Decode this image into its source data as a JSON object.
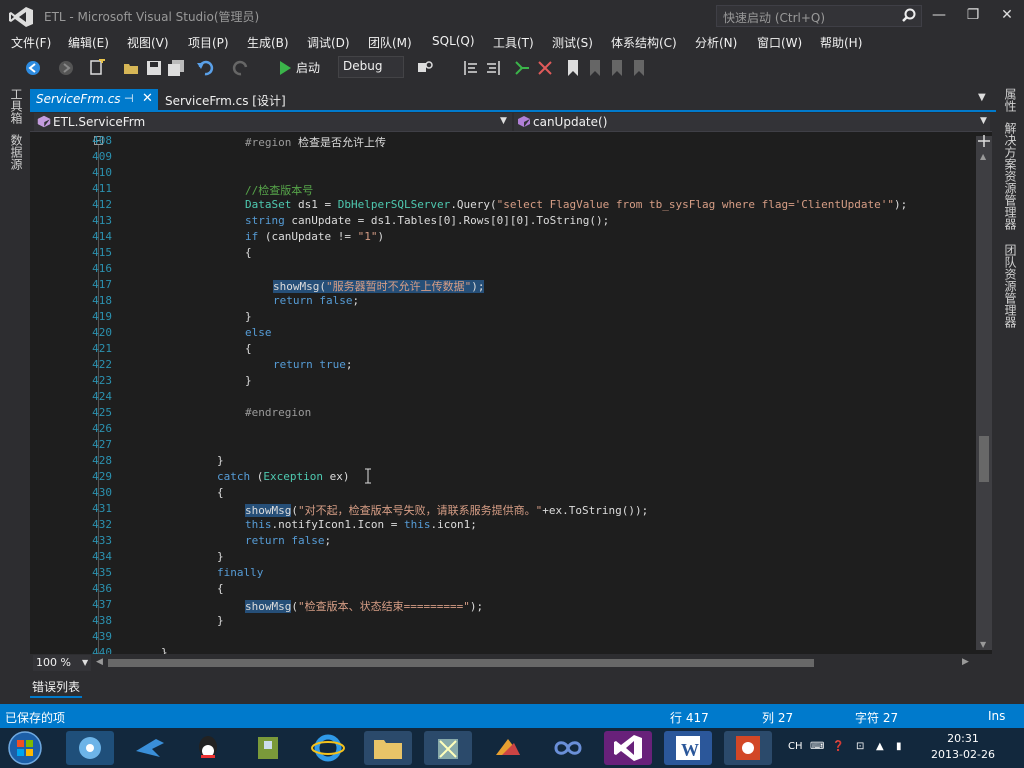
{
  "window": {
    "title": "ETL - Microsoft Visual Studio(管理员)",
    "quick_launch_placeholder": "快速启动 (Ctrl+Q)"
  },
  "menu": [
    "文件(F)",
    "编辑(E)",
    "视图(V)",
    "项目(P)",
    "生成(B)",
    "调试(D)",
    "团队(M)",
    "SQL(Q)",
    "工具(T)",
    "测试(S)",
    "体系结构(C)",
    "分析(N)",
    "窗口(W)",
    "帮助(H)"
  ],
  "toolbar": {
    "start_label": "启动",
    "config_value": "Debug"
  },
  "left_panels": [
    "工具箱",
    "数据源"
  ],
  "right_panels": [
    "属性",
    "解决方案资源管理器",
    "团队资源管理器"
  ],
  "tabs": [
    {
      "label": "ServiceFrm.cs"
    },
    {
      "label": "ServiceFrm.cs [设计]"
    }
  ],
  "navbar": {
    "type_value": "ETL.ServiceFrm",
    "member_value": "canUpdate()"
  },
  "code": {
    "line_numbers": [
      "408",
      "409",
      "410",
      "411",
      "412",
      "413",
      "414",
      "415",
      "416",
      "417",
      "418",
      "419",
      "420",
      "421",
      "422",
      "423",
      "424",
      "425",
      "426",
      "427",
      "428",
      "429",
      "430",
      "431",
      "432",
      "433",
      "434",
      "435",
      "436",
      "437",
      "438",
      "439",
      "440"
    ]
  },
  "editor": {
    "zoom": "100 %"
  },
  "bottom_panel": {
    "tab": "错误列表"
  },
  "status": {
    "left": "已保存的项",
    "line": "行 417",
    "col": "列 27",
    "char": "字符 27",
    "mode": "Ins"
  },
  "taskbar": {
    "ime": "CH",
    "time": "20:31",
    "date": "2013-02-26"
  },
  "colors": {
    "accent": "#007acc",
    "editor_bg": "#1e1e1e",
    "chrome_bg": "#2d2d30"
  }
}
